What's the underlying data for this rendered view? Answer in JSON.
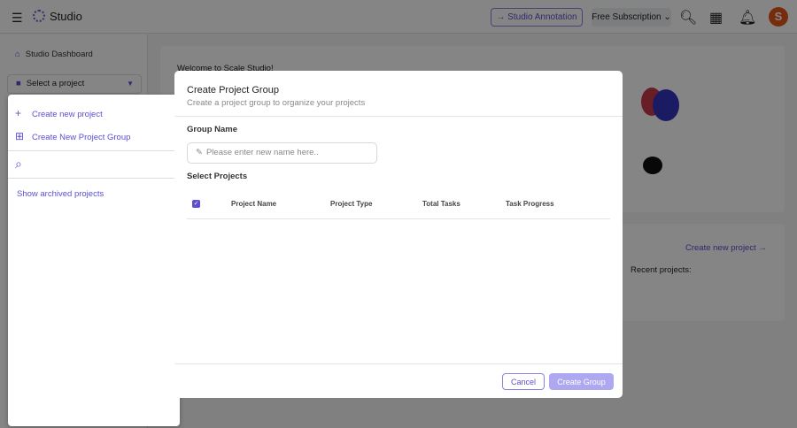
{
  "header": {
    "brand": "Studio",
    "annotation_button": "→ Studio Annotation",
    "subscription": "Free Subscription",
    "avatar_letter": "S"
  },
  "sidebar": {
    "dashboard": "Studio Dashboard",
    "select_project": "Select a project",
    "dropdown": {
      "create_project": "Create new project",
      "create_group": "Create New Project Group",
      "show_archived": "Show archived projects"
    }
  },
  "main": {
    "welcome": "Welcome to Scale Studio!",
    "create_new_project": "Create new project →",
    "recent_projects": "Recent projects:"
  },
  "modal": {
    "title": "Create Project Group",
    "subtitle": "Create a project group to organize your projects",
    "group_name_label": "Group Name",
    "group_name_placeholder": "Please enter new name here..",
    "group_name_value": "",
    "select_projects_label": "Select Projects",
    "columns": [
      "Project Name",
      "Project Type",
      "Total Tasks",
      "Task Progress"
    ],
    "rows": [],
    "select_all_checked": true,
    "cancel": "Cancel",
    "create": "Create Group"
  },
  "colors": {
    "accent": "#5b4fd0",
    "create_disabled": "#aea8f0"
  }
}
